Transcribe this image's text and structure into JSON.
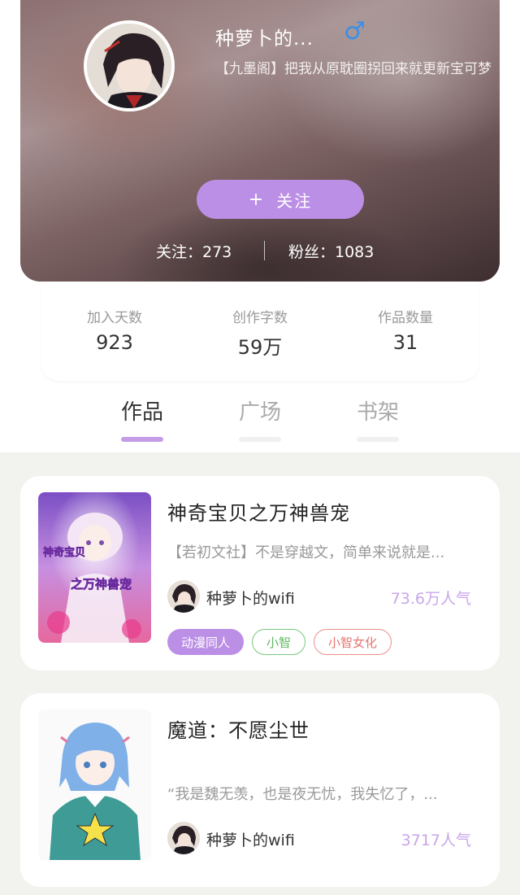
{
  "profile": {
    "nickname": "种萝卜的...",
    "gender_symbol": "♂",
    "bio": "【九墨阁】把我从原耽圈拐回来就更新宝可梦",
    "follow_button": "关注",
    "follow_plus": "+",
    "following_text": "关注：273",
    "fans_text": "粉丝：1083"
  },
  "stats": [
    {
      "label": "加入天数",
      "value": "923"
    },
    {
      "label": "创作字数",
      "value": "59万"
    },
    {
      "label": "作品数量",
      "value": "31"
    }
  ],
  "tabs": [
    {
      "label": "作品",
      "active": true
    },
    {
      "label": "广场",
      "active": false
    },
    {
      "label": "书架",
      "active": false
    }
  ],
  "books": [
    {
      "title": "神奇宝贝之万神兽宠",
      "desc": "【若初文社】不是穿越文，简单来说就是...",
      "cover_text_1": "神奇宝贝",
      "cover_text_2": "之万神兽宠",
      "author": "种萝卜的wifi",
      "popularity": "73.6万人气",
      "tags": [
        "动漫同人",
        "小智",
        "小智女化"
      ]
    },
    {
      "title": "魔道：不愿尘世",
      "desc": "“我是魏无羡，也是夜无忧，我失忆了，...",
      "author": "种萝卜的wifi",
      "popularity": "3717人气"
    }
  ],
  "colors": {
    "accent": "#bb8fe6",
    "popularity": "#c8a6ea",
    "tag_green": "#7ac77f",
    "tag_red": "#ec8f8a",
    "gender": "#3a8fe8"
  }
}
